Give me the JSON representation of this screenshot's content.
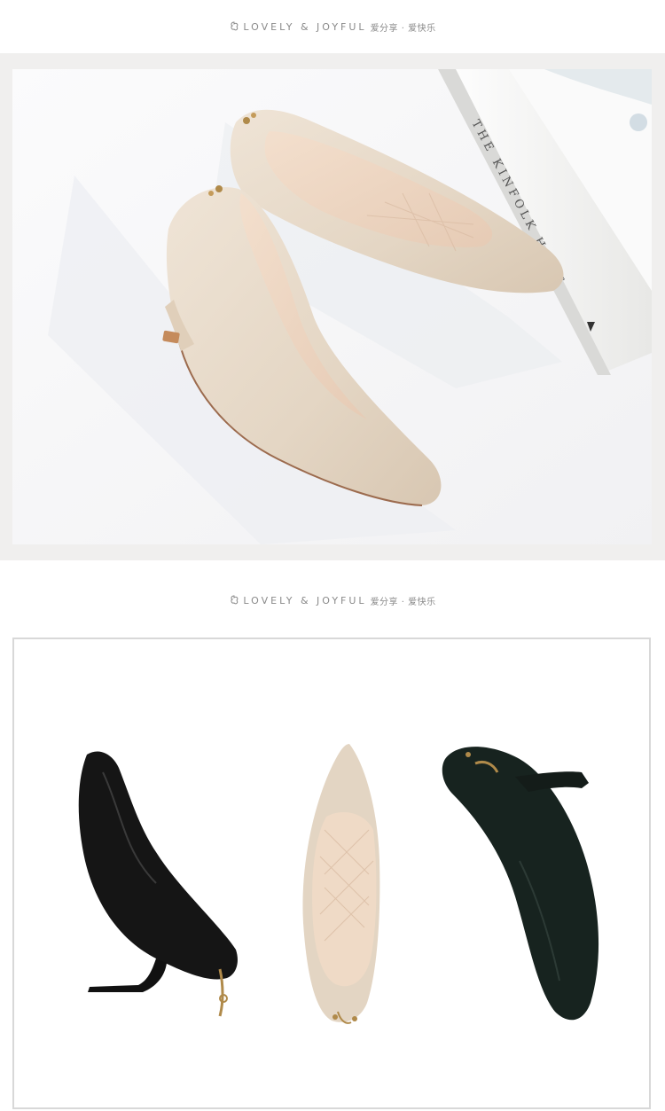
{
  "brand": {
    "english": "LOVELY & JOYFUL",
    "chinese": "爱分享 · 爱快乐",
    "mark_icon": "flower-logo-icon"
  },
  "photo_1": {
    "book_text": "THE KINFOLK HOME",
    "colors": {
      "background": "#f7f7f8",
      "shoe": "#e6d9c8",
      "lining": "#efd9c6",
      "book": "#f4f4f3"
    }
  },
  "photo_2": {
    "colors": {
      "black_shoe": "#151515",
      "dark_green_shoe": "#17231f",
      "beige_shoe": "#e3d5c3"
    }
  }
}
